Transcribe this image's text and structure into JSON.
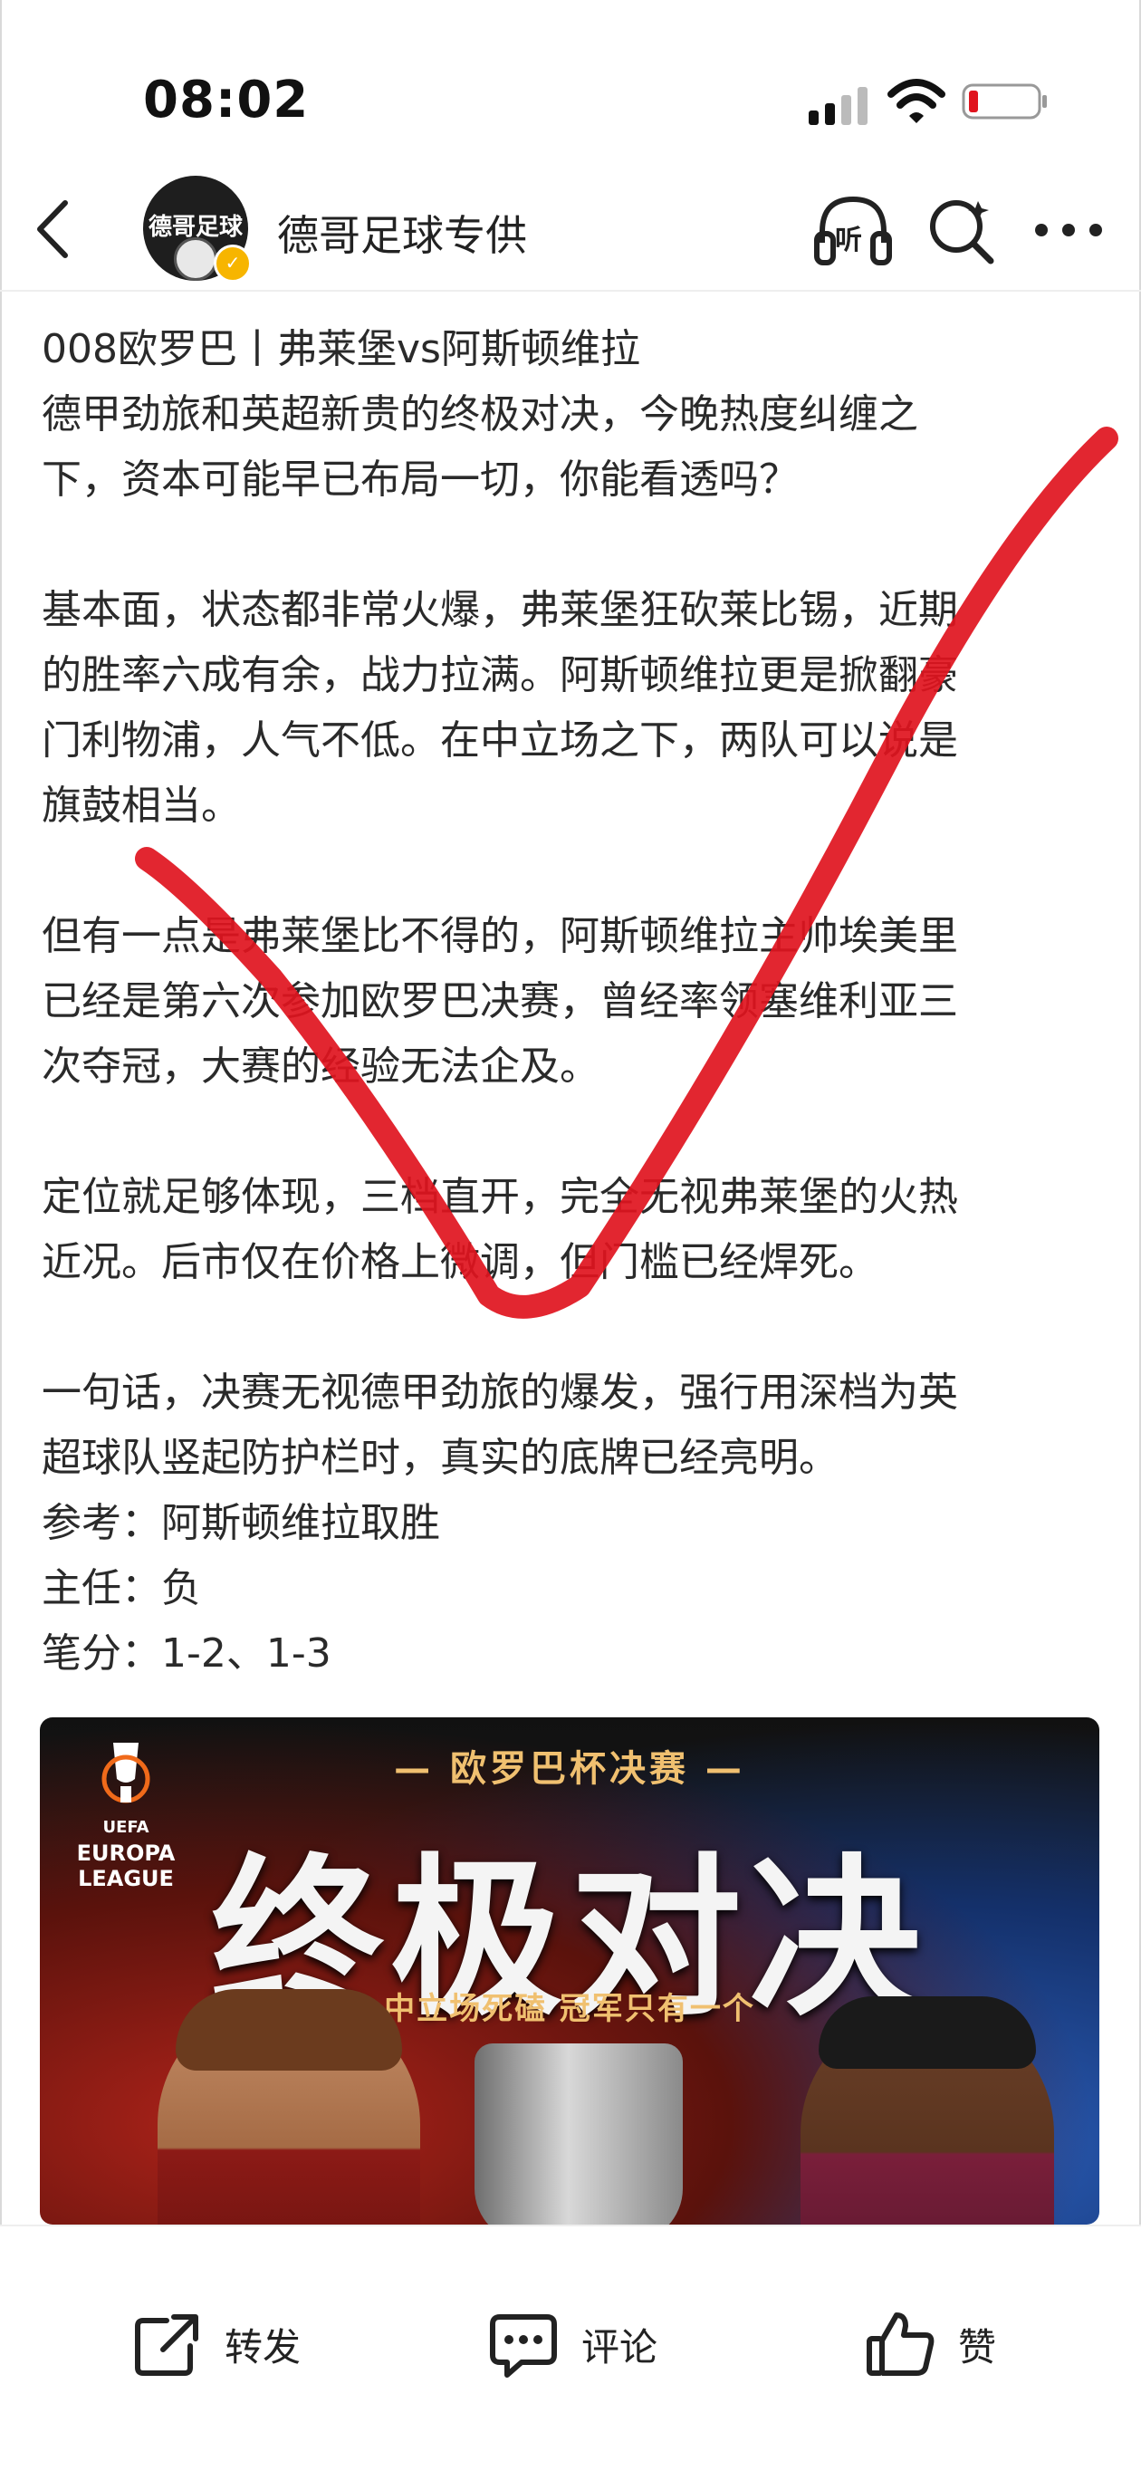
{
  "status_bar": {
    "time": "08:02"
  },
  "header": {
    "avatar_text": "德哥足球",
    "account_name": "德哥足球专供",
    "listen_label": "听"
  },
  "article": {
    "lines": [
      "008欧罗巴丨弗莱堡vs阿斯顿维拉",
      "德甲劲旅和英超新贵的终极对决，今晚热度纠缠之",
      "下，资本可能早已布局一切，你能看透吗？",
      "",
      "基本面，状态都非常火爆，弗莱堡狂砍莱比锡，近期",
      "的胜率六成有余，战力拉满。阿斯顿维拉更是掀翻豪",
      "门利物浦，人气不低。在中立场之下，两队可以说是",
      "旗鼓相当。",
      "",
      "但有一点是弗莱堡比不得的，阿斯顿维拉主帅埃美里",
      "已经是第六次参加欧罗巴决赛，曾经率领塞维利亚三",
      "次夺冠，大赛的经验无法企及。",
      "",
      "定位就足够体现，三档直开，完全无视弗莱堡的火热",
      "近况。后市仅在价格上微调，但门槛已经焊死。",
      "",
      "一句话，决赛无视德甲劲旅的爆发，强行用深档为英",
      "超球队竖起防护栏时，真实的底牌已经亮明。",
      "参考：阿斯顿维拉取胜",
      "主任：负",
      "笔分：1-2、1-3"
    ]
  },
  "poster": {
    "subtitle": "— 欧罗巴杯决赛 —",
    "title": "终极对决",
    "tagline": "中立场死磕   冠军只有一个",
    "logo_lines": [
      "UEFA",
      "EUROPA",
      "LEAGUE"
    ]
  },
  "bottom_bar": {
    "share_label": "转发",
    "comment_label": "评论",
    "like_label": "赞"
  },
  "colors": {
    "check_mark": "#e0141e",
    "badge": "#f7b500"
  }
}
